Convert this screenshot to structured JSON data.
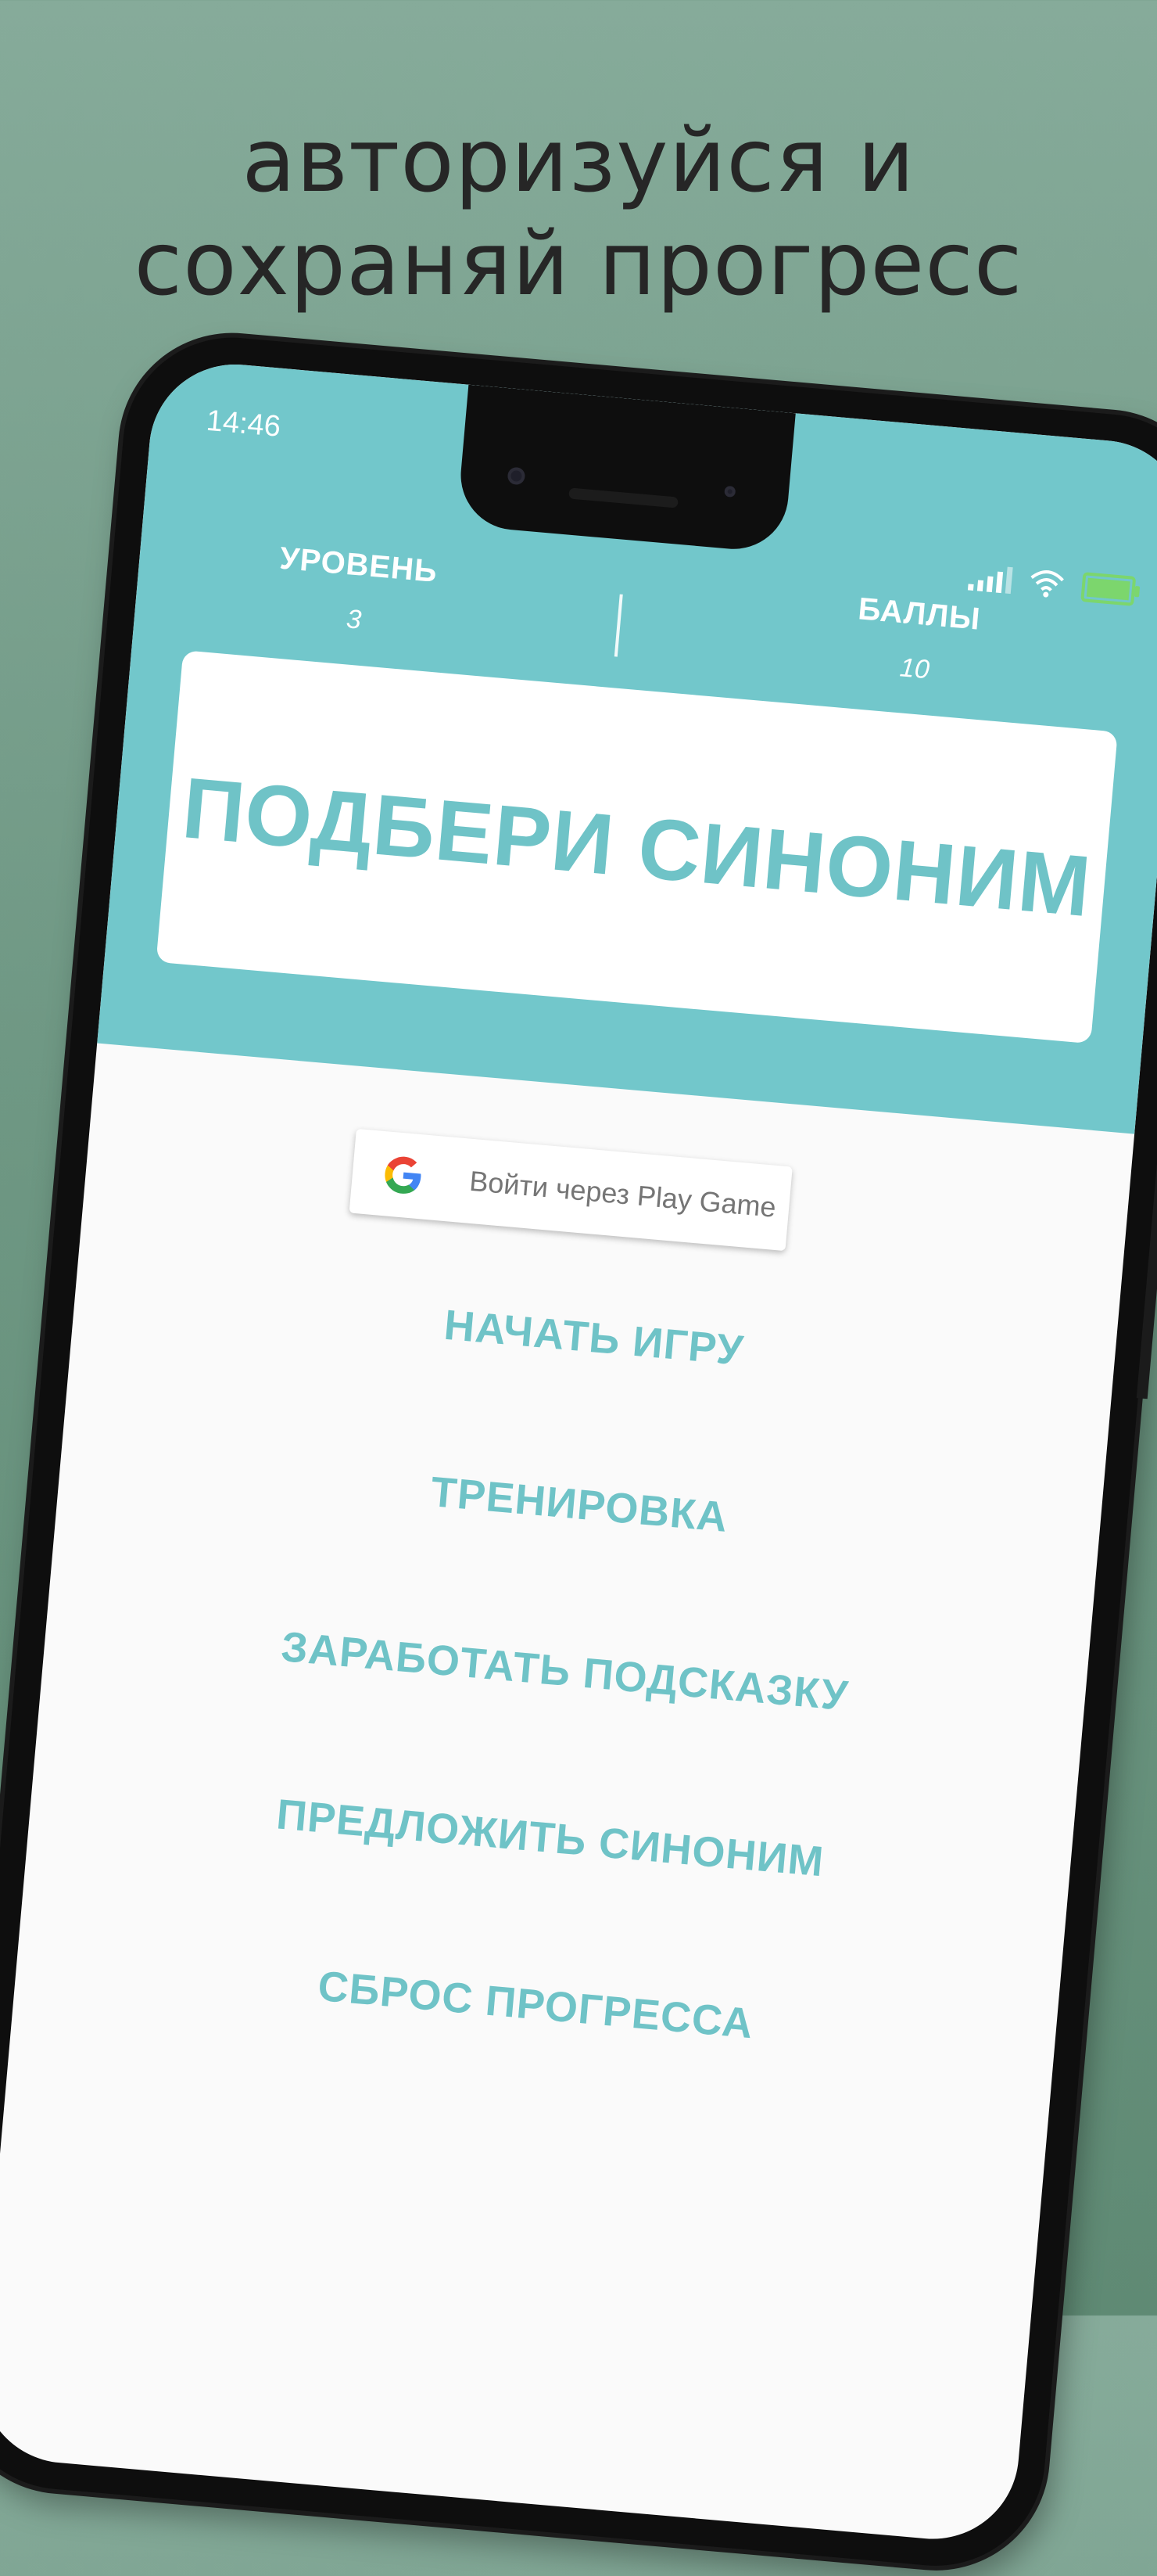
{
  "headline": {
    "line1": "авторизуйся и",
    "line2": "сохраняй прогресс"
  },
  "status_bar": {
    "time": "14:46",
    "icons": [
      "signal-icon",
      "wifi-icon",
      "battery-charging-icon"
    ],
    "battery_color": "#7cd66d"
  },
  "stats": {
    "level_label": "УРОВЕНЬ",
    "level_value": "3",
    "points_label": "БАЛЛЫ",
    "points_value": "10"
  },
  "app": {
    "title": "ПОДБЕРИ СИНОНИМ",
    "accent_color": "#72c7cb"
  },
  "google_signin": {
    "label": "Войти через Play Game",
    "icon": "google-g-icon"
  },
  "menu": {
    "items": [
      "НАЧАТЬ ИГРУ",
      "ТРЕНИРОВКА",
      "ЗАРАБОТАТЬ ПОДСКАЗКУ",
      "ПРЕДЛОЖИТЬ СИНОНИМ",
      "СБРОС ПРОГРЕССА"
    ]
  },
  "colors": {
    "background": "#6f9884",
    "headline_text": "#262626",
    "screen_bg": "#fafafa",
    "menu_text": "#6fc3c7"
  }
}
